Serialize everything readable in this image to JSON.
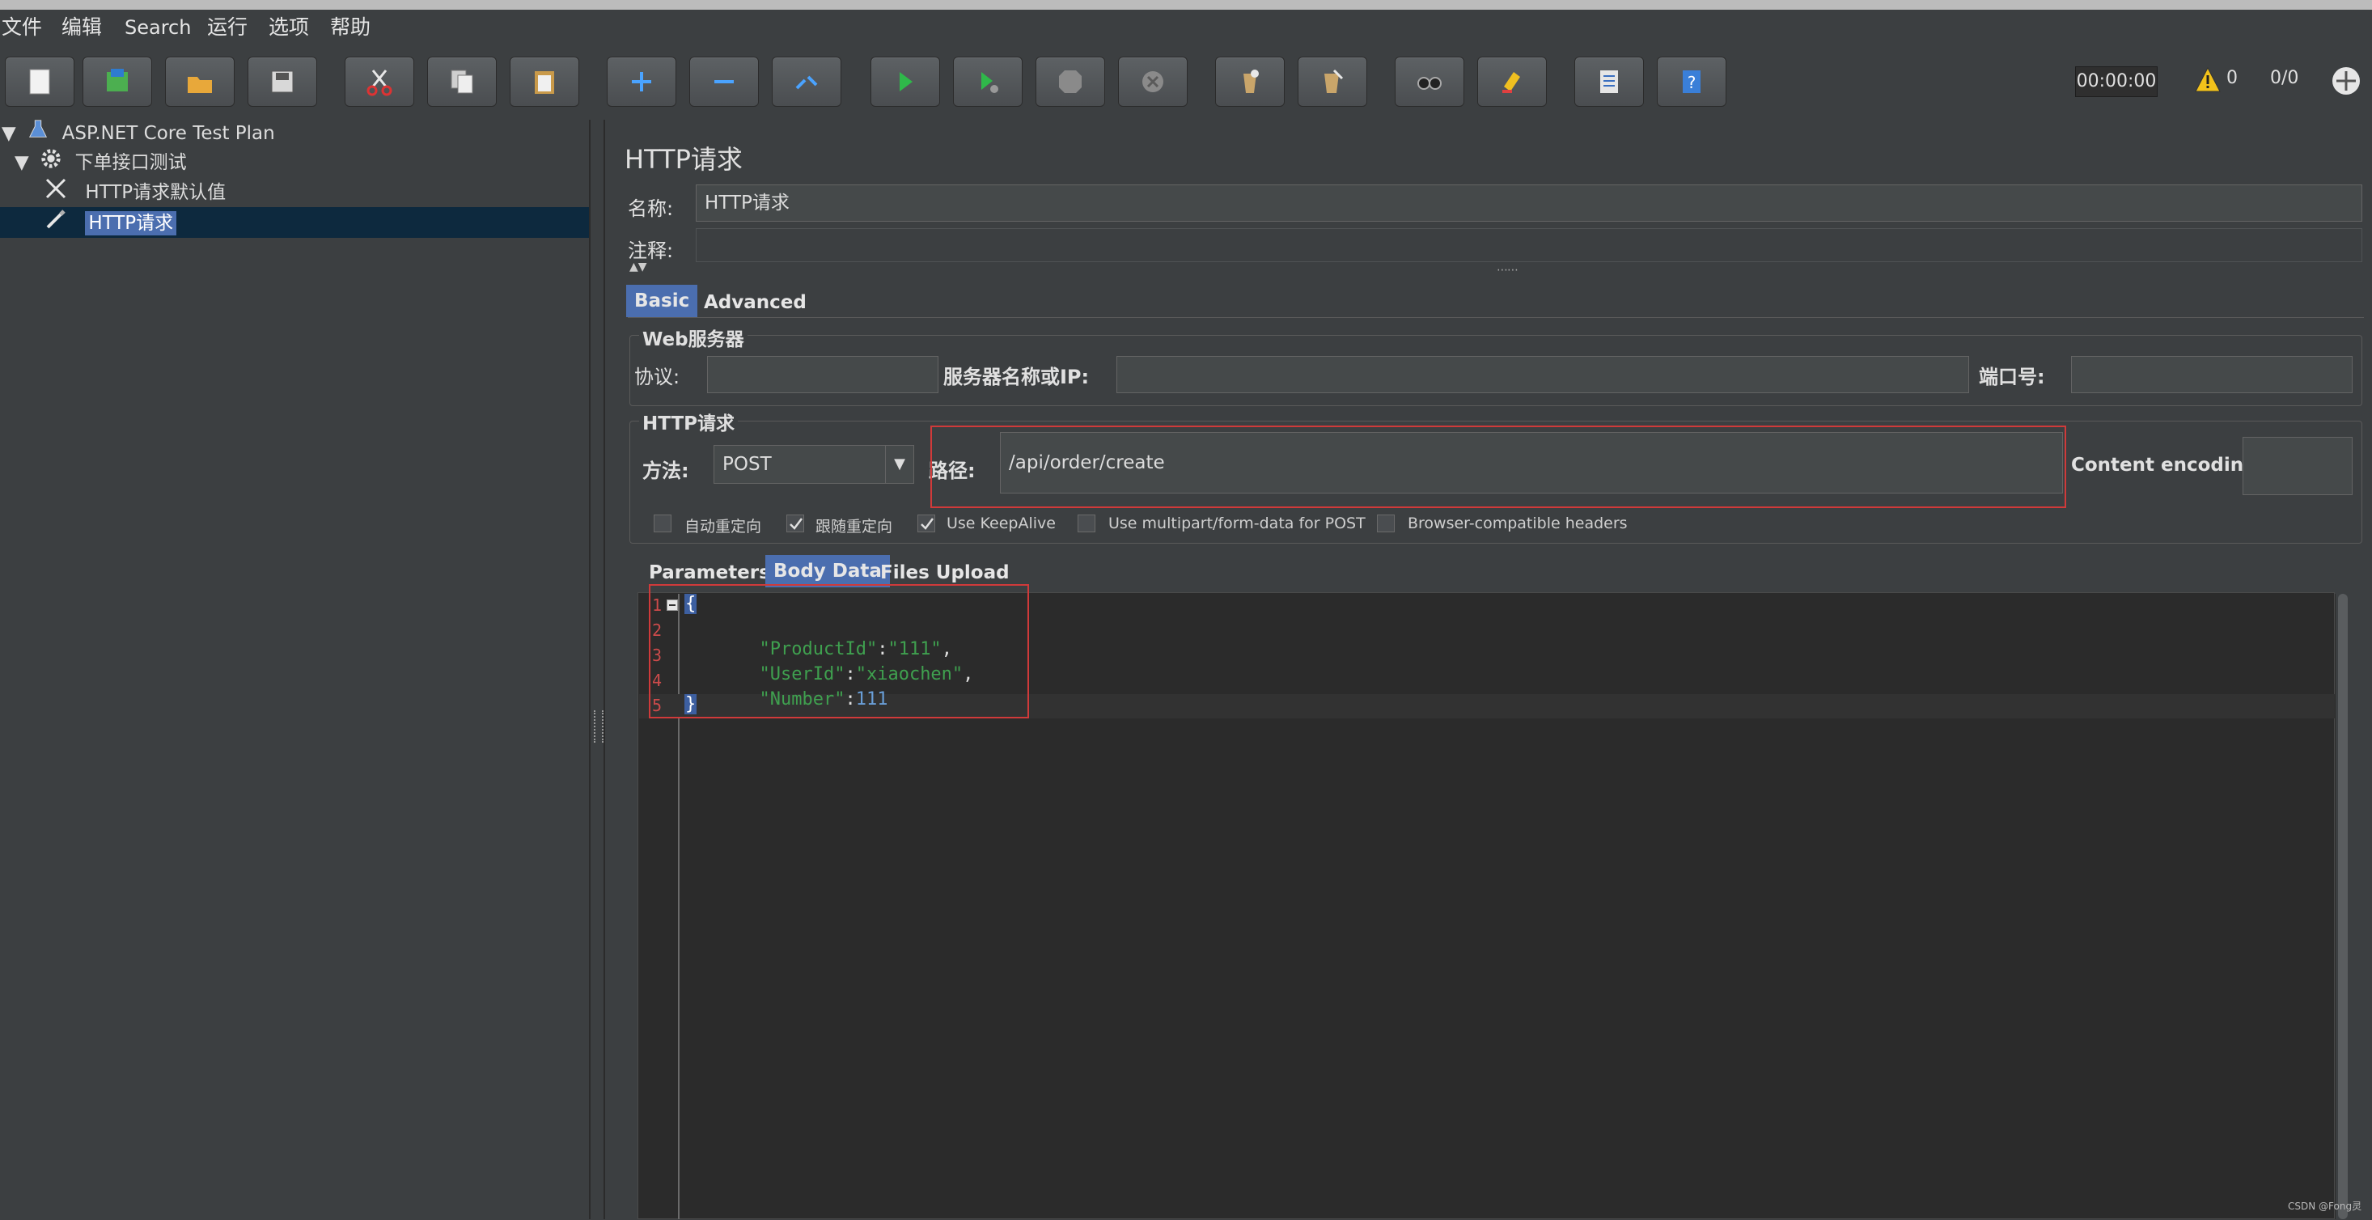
{
  "menu": [
    "文件",
    "编辑",
    "Search",
    "运行",
    "选项",
    "帮助"
  ],
  "toolbar": {
    "timer": "00:00:00",
    "warning_count": "0",
    "thread_count": "0/0",
    "icons": [
      "new-icon",
      "templates-icon",
      "open-icon",
      "save-icon",
      "cut-icon",
      "copy-icon",
      "paste-icon",
      "expand-icon",
      "collapse-icon",
      "toggle-icon",
      "start-icon",
      "start-no-pause-icon",
      "stop-icon",
      "shutdown-icon",
      "clear-icon",
      "clear-all-icon",
      "search-icon",
      "reset-search-icon",
      "function-helper-icon",
      "help-icon"
    ]
  },
  "tree": [
    {
      "label": "ASP.NET Core Test Plan",
      "icon": "flask-icon"
    },
    {
      "label": "下单接口测试",
      "icon": "gear-icon"
    },
    {
      "label": "HTTP请求默认值",
      "icon": "wrench-icon"
    },
    {
      "label": "HTTP请求",
      "icon": "pipette-icon",
      "selected": true
    }
  ],
  "panel": {
    "title": "HTTP请求",
    "name_label": "名称:",
    "name_value": "HTTP请求",
    "comment_label": "注释:",
    "tabs": [
      "Basic",
      "Advanced"
    ],
    "web_server": {
      "title": "Web服务器",
      "protocol_label": "协议:",
      "protocol_value": "",
      "server_label": "服务器名称或IP:",
      "server_value": "",
      "port_label": "端口号:",
      "port_value": ""
    },
    "http_request": {
      "title": "HTTP请求",
      "method_label": "方法:",
      "method_value": "POST",
      "path_label": "路径:",
      "path_value": "/api/order/create",
      "encoding_label": "Content encoding:",
      "encoding_value": ""
    },
    "checkboxes": [
      {
        "label": "自动重定向",
        "checked": false
      },
      {
        "label": "跟随重定向",
        "checked": true
      },
      {
        "label": "Use KeepAlive",
        "checked": true
      },
      {
        "label": "Use multipart/form-data for POST",
        "checked": false
      },
      {
        "label": "Browser-compatible headers",
        "checked": false
      }
    ],
    "body_tabs": [
      "Parameters",
      "Body Data",
      "Files Upload"
    ]
  },
  "editor": {
    "line_numbers": [
      "1",
      "2",
      "3",
      "4",
      "5"
    ],
    "open_brace": "{",
    "close_brace": "}",
    "lines": [
      {
        "key": "\"ProductId\"",
        "sep": ":",
        "value": "\"111\"",
        "end": ","
      },
      {
        "key": "\"UserId\"",
        "sep": ":",
        "value": "\"xiaochen\"",
        "end": ","
      },
      {
        "key": "\"Number\"",
        "sep": ":",
        "value": "111",
        "end": ""
      }
    ]
  },
  "watermark": "CSDN @Fong灵",
  "colors": {
    "accent": "#4b6eaf",
    "highlight_box": "#d03a3a",
    "json_string": "#3fa04f",
    "json_number": "#6a9fd8"
  }
}
